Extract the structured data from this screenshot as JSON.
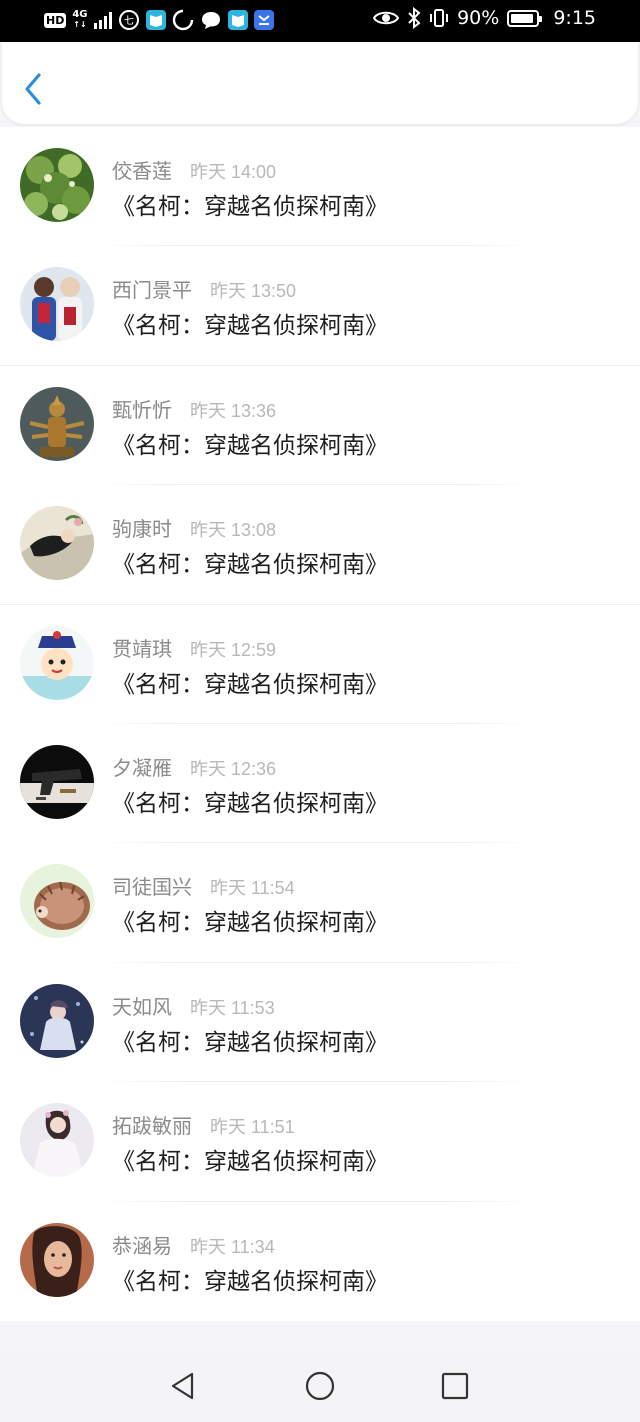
{
  "status_bar": {
    "hd": "HD",
    "network": "4G",
    "battery_text": "90%",
    "battery_level": 0.9,
    "clock": "9:15",
    "icons": [
      "hd-icon",
      "signal-icon",
      "app-icon",
      "reader-icon",
      "loading-icon",
      "chat-icon",
      "reader-icon",
      "app-icon",
      "eye-icon",
      "bluetooth-icon",
      "vibrate-icon",
      "battery-icon"
    ]
  },
  "header": {
    "back_icon": "chevron-left-icon",
    "accent": "#2d8ee0"
  },
  "messages": [
    {
      "name": "佼香莲",
      "time": "昨天 14:00",
      "text": "《名柯：穿越名侦探柯南》"
    },
    {
      "name": "西门景平",
      "time": "昨天 13:50",
      "text": "《名柯：穿越名侦探柯南》"
    },
    {
      "name": "甄忻忻",
      "time": "昨天 13:36",
      "text": "《名柯：穿越名侦探柯南》"
    },
    {
      "name": "驹康时",
      "time": "昨天 13:08",
      "text": "《名柯：穿越名侦探柯南》"
    },
    {
      "name": "贯靖琪",
      "time": "昨天 12:59",
      "text": "《名柯：穿越名侦探柯南》"
    },
    {
      "name": "夕凝雁",
      "time": "昨天 12:36",
      "text": "《名柯：穿越名侦探柯南》"
    },
    {
      "name": "司徒国兴",
      "time": "昨天 11:54",
      "text": "《名柯：穿越名侦探柯南》"
    },
    {
      "name": "天如风",
      "time": "昨天 11:53",
      "text": "《名柯：穿越名侦探柯南》"
    },
    {
      "name": "拓跋敏丽",
      "time": "昨天 11:51",
      "text": "《名柯：穿越名侦探柯南》"
    },
    {
      "name": "恭涵易",
      "time": "昨天 11:34",
      "text": "《名柯：穿越名侦探柯南》"
    }
  ],
  "nav_bar": {
    "icons": [
      "back-triangle-icon",
      "home-circle-icon",
      "recents-square-icon"
    ]
  }
}
